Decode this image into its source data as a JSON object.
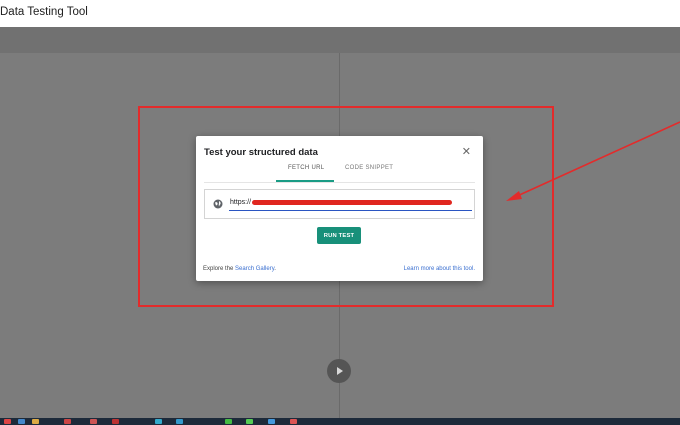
{
  "app": {
    "title": "Data Testing Tool"
  },
  "dialog": {
    "title": "Test your structured data",
    "close_symbol": "✕",
    "tabs": [
      {
        "label": "FETCH URL",
        "active": true
      },
      {
        "label": "CODE SNIPPET",
        "active": false
      }
    ],
    "url_prefix": "https://",
    "run_button": "RUN TEST",
    "footer_left_prefix": "Explore the ",
    "footer_left_link": "Search Gallery",
    "footer_left_suffix": ".",
    "footer_right_link": "Learn more about this tool."
  },
  "colors": {
    "accent": "#1a9c85",
    "annotation": "#e32b2b",
    "link": "#3a6fd0",
    "redaction": "#e0261f"
  },
  "icons": [
    "globe-icon",
    "close-icon",
    "play-icon"
  ]
}
